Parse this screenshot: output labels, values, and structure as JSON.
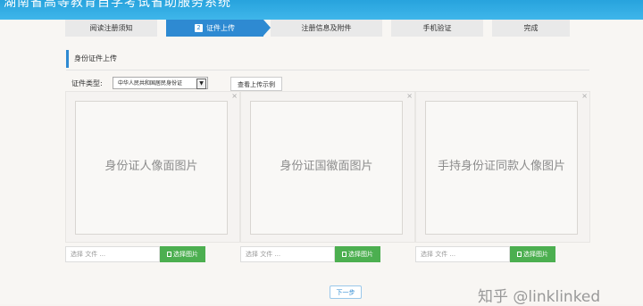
{
  "header": {
    "title": "湖南省高等教育自学考试省助服务系统"
  },
  "steps": [
    {
      "label": "阅读注册须知",
      "number": "",
      "active": false
    },
    {
      "label": "证件上传",
      "number": "2",
      "active": true
    },
    {
      "label": "注册信息及附件",
      "number": "",
      "active": false
    },
    {
      "label": "手机验证",
      "number": "",
      "active": false
    },
    {
      "label": "完成",
      "number": "",
      "active": false
    }
  ],
  "section": {
    "title": "身份证件上传"
  },
  "id_type": {
    "label": "证件类型:",
    "selected": "中华人民共和国居民身份证",
    "sample_button": "查看上传示例"
  },
  "panels": [
    {
      "text": "身份证人像面图片",
      "file_placeholder": "选择 文件 ...",
      "button": "选择图片",
      "close": "×"
    },
    {
      "text": "身份证国徽面图片",
      "file_placeholder": "选择 文件 ...",
      "button": "选择图片",
      "close": "×"
    },
    {
      "text": "手持身份证同款人像图片",
      "file_placeholder": "选择 文件 ...",
      "button": "选择图片",
      "close": "×"
    }
  ],
  "next_button": "下一步",
  "watermark": "知乎 @linklinked",
  "colors": {
    "header": "#2aa5df",
    "accent": "#2e8ad2",
    "green": "#4caf50",
    "step_inactive": "#e9e9e9"
  }
}
